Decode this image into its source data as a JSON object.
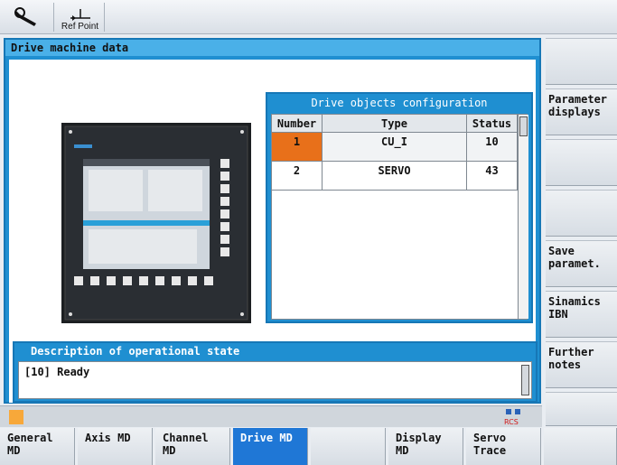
{
  "toolbar": {
    "refpoint_label": "Ref Point"
  },
  "window": {
    "title": "Drive machine data"
  },
  "drive_objects": {
    "title": "Drive objects configuration",
    "headers": [
      "Number",
      "Type",
      "Status"
    ],
    "rows": [
      {
        "number": "1",
        "type": "CU_I",
        "status": "10",
        "selected": true
      },
      {
        "number": "2",
        "type": "SERVO",
        "status": "43",
        "selected": false
      }
    ]
  },
  "description": {
    "title": "Description of operational state",
    "text": "[10] Ready"
  },
  "right_softkeys": [
    "",
    "Parameter displays",
    "",
    "",
    "Save paramet.",
    "Sinamics IBN",
    "Further notes",
    ""
  ],
  "bottom_softkeys": [
    {
      "label": "General MD",
      "active": false
    },
    {
      "label": "Axis MD",
      "active": false
    },
    {
      "label": "Channel MD",
      "active": false
    },
    {
      "label": "Drive MD",
      "active": true
    },
    {
      "label": "",
      "active": false
    },
    {
      "label": "Display MD",
      "active": false
    },
    {
      "label": "Servo Trace",
      "active": false
    },
    {
      "label": "",
      "active": false
    }
  ],
  "status": {
    "rcs_label": "RCS"
  },
  "colors": {
    "accent": "#1f8fd1",
    "selected_cell": "#e8701a",
    "active_softkey": "#1f77d6"
  }
}
